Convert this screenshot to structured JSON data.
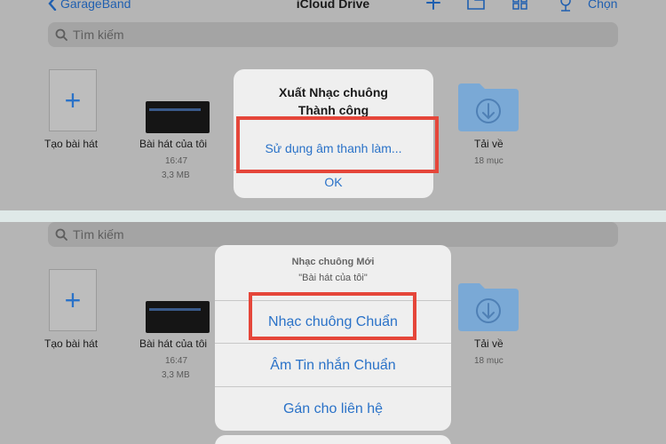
{
  "nav": {
    "back_label": "GarageBand",
    "title": "iCloud Drive",
    "select_label": "Chọn"
  },
  "search": {
    "placeholder": "Tìm kiếm"
  },
  "items": {
    "new_song": {
      "label": "Tạo bài hát"
    },
    "my_song": {
      "label": "Bài hát của tôi",
      "time": "16:47",
      "size": "3,3 MB"
    },
    "downloads": {
      "label": "Tải về",
      "count": "18 mục"
    }
  },
  "export_dialog": {
    "title_line1": "Xuất Nhạc chuông",
    "title_line2": "Thành công",
    "use_sound_label": "Sử dụng âm thanh làm...",
    "ok_label": "OK"
  },
  "ringtone_sheet": {
    "title": "Nhạc chuông Mới",
    "subtitle": "\"Bài hát của tôi\"",
    "standard_ringtone_label": "Nhạc chuông Chuẩn",
    "standard_text_tone_label": "Âm Tin nhắn Chuẩn",
    "assign_contact_label": "Gán cho liên hệ"
  },
  "colors": {
    "accent": "#2a72c8",
    "highlight": "#e5463a",
    "dim_background": "#b5b5b5",
    "folder": "#7aa9d6"
  }
}
